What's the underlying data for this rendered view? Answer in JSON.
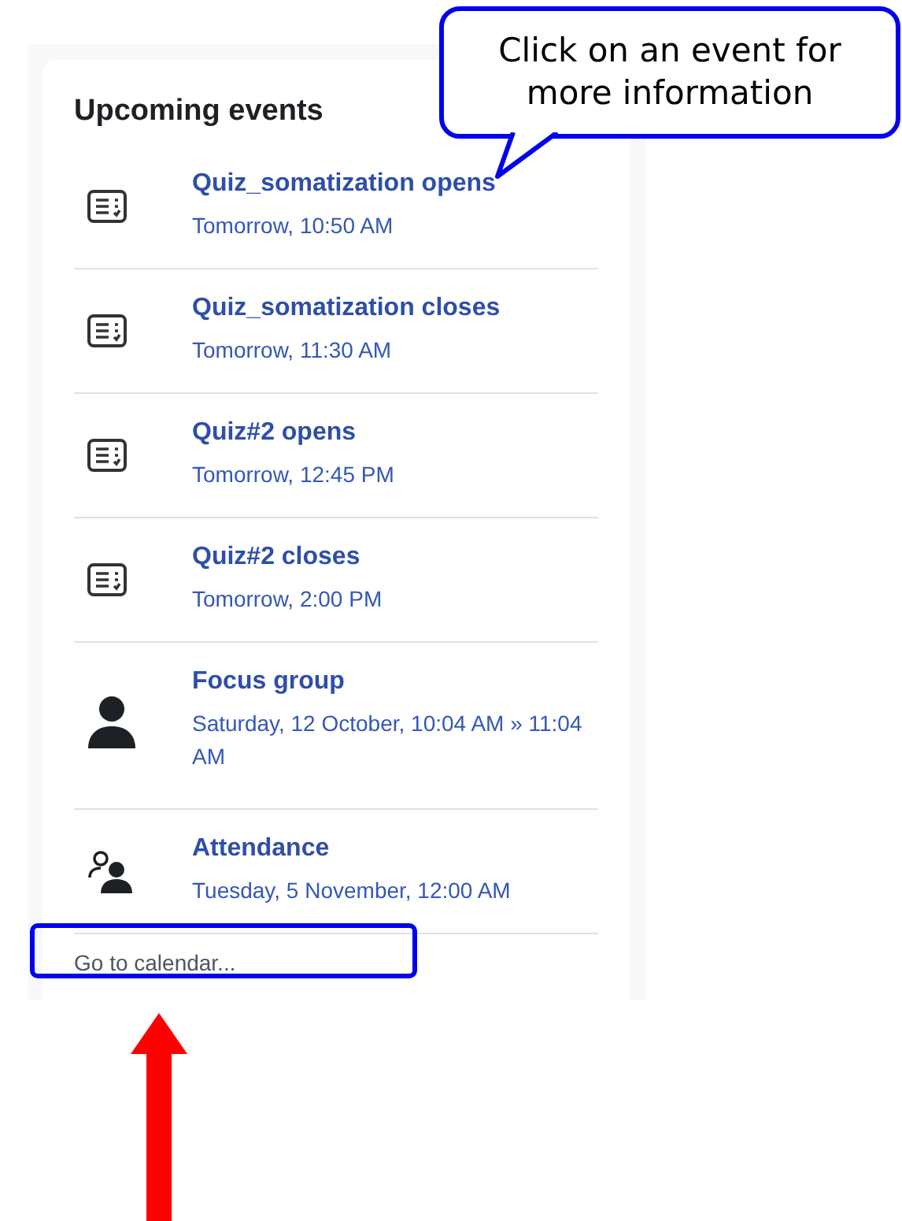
{
  "block": {
    "title": "Upcoming events",
    "events": [
      {
        "kind": "quiz",
        "name": "Quiz_somatization opens",
        "when": "Tomorrow, 10:50 AM"
      },
      {
        "kind": "quiz",
        "name": "Quiz_somatization closes",
        "when": "Tomorrow, 11:30 AM"
      },
      {
        "kind": "quiz",
        "name": "Quiz#2 opens",
        "when": "Tomorrow, 12:45 PM"
      },
      {
        "kind": "quiz",
        "name": "Quiz#2 closes",
        "when": "Tomorrow, 2:00 PM"
      },
      {
        "kind": "user",
        "name": "Focus group",
        "when": "Saturday, 12 October, 10:04 AM » 11:04 AM"
      },
      {
        "kind": "group",
        "name": "Attendance",
        "when": "Tuesday, 5 November, 12:00 AM"
      }
    ],
    "footer_link": "Go to calendar..."
  },
  "callout": {
    "text": "Click on an event for more information"
  }
}
